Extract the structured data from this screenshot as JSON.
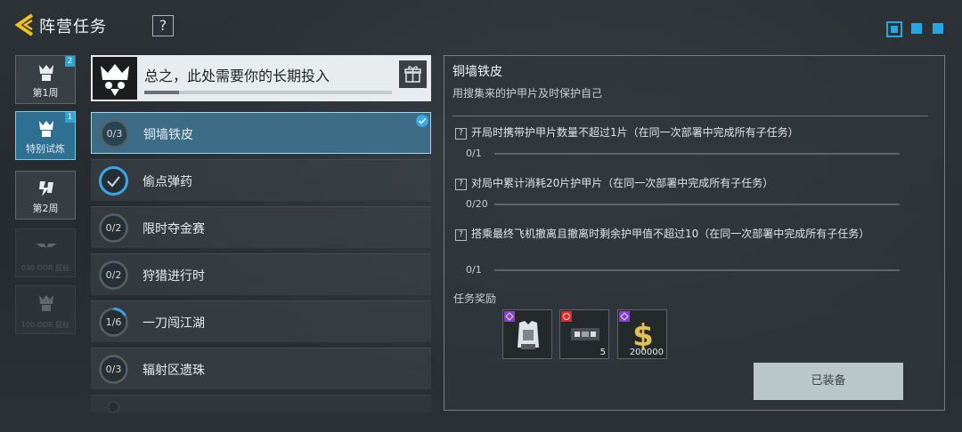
{
  "header": {
    "title": "阵营任务",
    "help_label": "?"
  },
  "pager": {
    "pages": 3,
    "current": 1
  },
  "weeks": [
    {
      "label": "第1周",
      "badge": "2"
    },
    {
      "label": "特别试炼",
      "badge": "1"
    },
    {
      "label": "第2周"
    },
    {
      "label": "030 DDR 鼠标"
    },
    {
      "label": "100 DDR 鼠标"
    }
  ],
  "event": {
    "title": "总之，此处需要你的长期投入",
    "progress": 0.14
  },
  "tasks": [
    {
      "name": "铜墙铁皮",
      "count": "0/3",
      "progress": 0
    },
    {
      "name": "偷点弹药",
      "count": "",
      "progress": 1
    },
    {
      "name": "限时夺金赛",
      "count": "0/2",
      "progress": 0
    },
    {
      "name": "狩猎进行时",
      "count": "0/2",
      "progress": 0
    },
    {
      "name": "一刀闯江湖",
      "count": "1/6",
      "progress": 0.1667
    },
    {
      "name": "辐射区遗珠",
      "count": "0/3",
      "progress": 0
    }
  ],
  "detail": {
    "title": "铜墙铁皮",
    "description": "用搜集来的护甲片及时保护自己",
    "subtasks": [
      {
        "text": "开局时携带护甲片数量不超过1片（在同一次部署中完成所有子任务）",
        "progress": "0/1"
      },
      {
        "text": "对局中累计消耗20片护甲片（在同一次部署中完成所有子任务）",
        "progress": "0/20"
      },
      {
        "text": "搭乘最终飞机撤离且撤离时剩余护甲值不超过10（在同一次部署中完成所有子任务）",
        "progress": "0/1"
      }
    ],
    "rewards_label": "任务奖励",
    "rewards": [
      {
        "icon": "armor-vest-icon",
        "rarity_color": "#8a3fc9",
        "quantity": ""
      },
      {
        "icon": "armor-plate-icon",
        "rarity_color": "#d0302c",
        "quantity": "5"
      },
      {
        "icon": "currency-icon",
        "rarity_color": "#8a3fc9",
        "quantity": "200000"
      }
    ],
    "equip_label": "已装备"
  },
  "colors": {
    "accent": "#29a6df",
    "active_task": "#3d6d86"
  }
}
